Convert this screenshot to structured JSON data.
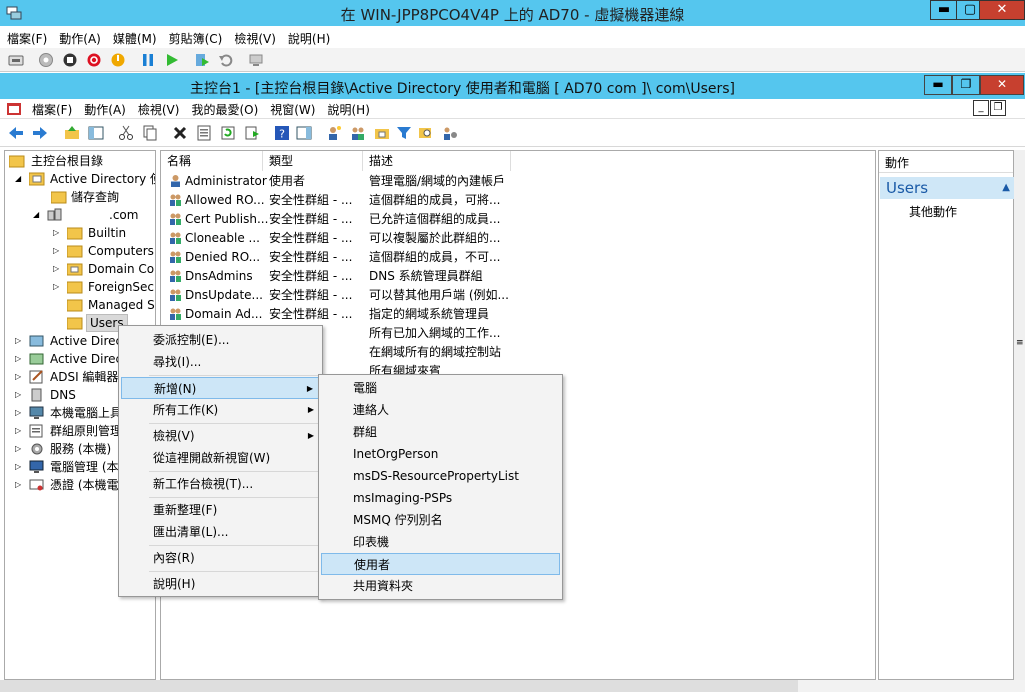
{
  "vm": {
    "title": "在 WIN-JPP8PCO4V4P 上的 AD70 - 虛擬機器連線",
    "controls": {
      "minimize": "▬",
      "maximize": "▢",
      "close": "✕"
    },
    "menu": [
      "檔案(F)",
      "動作(A)",
      "媒體(M)",
      "剪貼簿(C)",
      "檢視(V)",
      "說明(H)"
    ]
  },
  "mmc": {
    "title": "主控台1 - [主控台根目錄\\Active Directory 使用者和電腦 [ AD70          com ]\\          com\\Users]",
    "menu": [
      "檔案(F)",
      "動作(A)",
      "檢視(V)",
      "我的最愛(O)",
      "視窗(W)",
      "說明(H)"
    ],
    "controls": {
      "minimize": "▬",
      "restore": "❐",
      "close": "✕"
    }
  },
  "tree": [
    {
      "label": "主控台根目錄",
      "level": 0,
      "expander": ""
    },
    {
      "label": "Active Directory 使...",
      "level": 1,
      "expander": "open"
    },
    {
      "label": "儲存查詢",
      "level": 2,
      "expander": ""
    },
    {
      "label": ".com",
      "level": 2,
      "expander": "open"
    },
    {
      "label": "Builtin",
      "level": 3,
      "expander": "closed"
    },
    {
      "label": "Computers",
      "level": 3,
      "expander": "closed"
    },
    {
      "label": "Domain Cor",
      "level": 3,
      "expander": "closed"
    },
    {
      "label": "ForeignSecu",
      "level": 3,
      "expander": "closed"
    },
    {
      "label": "Managed S",
      "level": 3,
      "expander": ""
    },
    {
      "label": "Users",
      "level": 3,
      "expander": "",
      "selected": true
    },
    {
      "label": "Active Direct",
      "level": 0,
      "expander": "closed"
    },
    {
      "label": "Active Direct",
      "level": 0,
      "expander": "closed"
    },
    {
      "label": "ADSI 編輯器",
      "level": 0,
      "expander": "closed"
    },
    {
      "label": "DNS",
      "level": 0,
      "expander": "closed"
    },
    {
      "label": "本機電腦上具",
      "level": 0,
      "expander": "closed"
    },
    {
      "label": "群組原則管理",
      "level": 0,
      "expander": "closed"
    },
    {
      "label": "服務 (本機)",
      "level": 0,
      "expander": "closed"
    },
    {
      "label": "電腦管理 (本",
      "level": 0,
      "expander": "closed"
    },
    {
      "label": "憑證 (本機電",
      "level": 0,
      "expander": "closed"
    }
  ],
  "list": {
    "columns": [
      "名稱",
      "類型",
      "描述"
    ],
    "rows": [
      {
        "name": "Administrator",
        "type": "使用者",
        "desc": "管理電腦/網域的內建帳戶"
      },
      {
        "name": "Allowed RO...",
        "type": "安全性群組 - ...",
        "desc": "這個群組的成員，可將..."
      },
      {
        "name": "Cert Publish...",
        "type": "安全性群組 - ...",
        "desc": "已允許這個群組的成員..."
      },
      {
        "name": "Cloneable ...",
        "type": "安全性群組 - ...",
        "desc": "可以複製屬於此群組的..."
      },
      {
        "name": "Denied RO...",
        "type": "安全性群組 - ...",
        "desc": "這個群組的成員，不可..."
      },
      {
        "name": "DnsAdmins",
        "type": "安全性群組 - ...",
        "desc": "DNS 系統管理員群組"
      },
      {
        "name": "DnsUpdate...",
        "type": "安全性群組 - ...",
        "desc": "可以替其他用戶端 (例如..."
      },
      {
        "name": "Domain Ad...",
        "type": "安全性群組 - ...",
        "desc": "指定的網域系統管理員"
      },
      {
        "name": "",
        "type": "",
        "desc": "所有已加入網域的工作..."
      },
      {
        "name": "",
        "type": "",
        "desc": "在網域所有的網域控制站"
      },
      {
        "name": "",
        "type": "",
        "desc": "所有網域來賓"
      }
    ]
  },
  "actions": {
    "header": "動作",
    "section": "Users",
    "more": "其他動作"
  },
  "context_menu": [
    {
      "label": "委派控制(E)...",
      "arrow": ""
    },
    {
      "label": "尋找(I)...",
      "arrow": ""
    },
    {
      "label": "新增(N)",
      "arrow": "▶",
      "highlight": true
    },
    {
      "label": "所有工作(K)",
      "arrow": "▶"
    },
    {
      "label": "檢視(V)",
      "arrow": "▶"
    },
    {
      "label": "從這裡開啟新視窗(W)",
      "arrow": ""
    },
    {
      "label": "新工作台檢視(T)...",
      "arrow": ""
    },
    {
      "label": "重新整理(F)",
      "arrow": ""
    },
    {
      "label": "匯出清單(L)...",
      "arrow": ""
    },
    {
      "label": "內容(R)",
      "arrow": ""
    },
    {
      "label": "說明(H)",
      "arrow": ""
    }
  ],
  "submenu": [
    {
      "label": "電腦"
    },
    {
      "label": "連絡人"
    },
    {
      "label": "群組"
    },
    {
      "label": "InetOrgPerson"
    },
    {
      "label": "msDS-ResourcePropertyList"
    },
    {
      "label": "msImaging-PSPs"
    },
    {
      "label": "MSMQ 佇列別名"
    },
    {
      "label": "印表機"
    },
    {
      "label": "使用者",
      "highlight": true
    },
    {
      "label": "共用資料夾"
    }
  ],
  "colors": {
    "titlebar": "#55c6ee",
    "highlight": "#cde6f7",
    "folder": "#f2c54a"
  }
}
